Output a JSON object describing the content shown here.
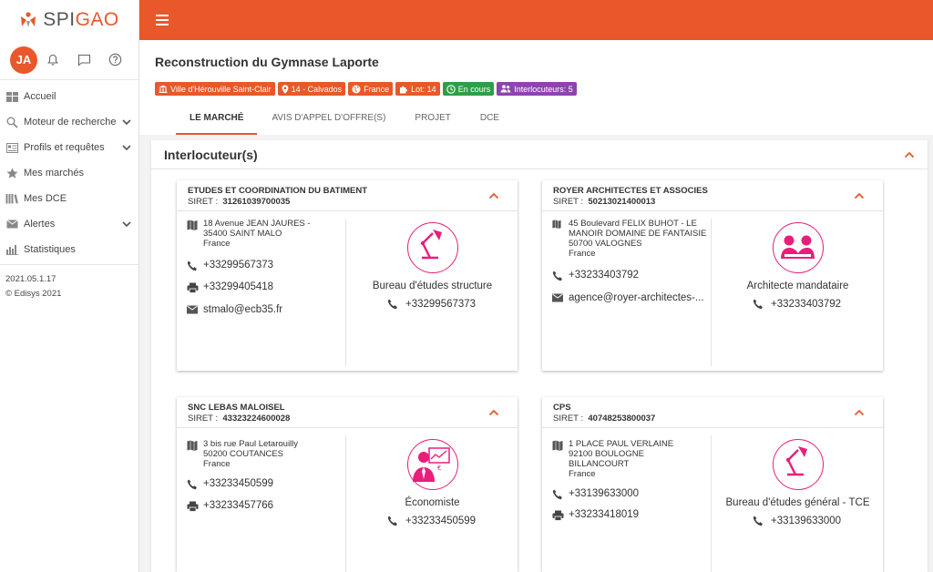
{
  "app": {
    "logo_prefix": "SPI",
    "logo_suffix": "GAO"
  },
  "user": {
    "initials": "JA"
  },
  "sidebar": {
    "items": [
      {
        "label": "Accueil",
        "icon": "dashboard-icon",
        "has_chevron": false
      },
      {
        "label": "Moteur de recherche",
        "icon": "search-icon",
        "has_chevron": true
      },
      {
        "label": "Profils et requêtes",
        "icon": "profile-icon",
        "has_chevron": true
      },
      {
        "label": "Mes marchés",
        "icon": "star-icon",
        "has_chevron": false
      },
      {
        "label": "Mes DCE",
        "icon": "books-icon",
        "has_chevron": false
      },
      {
        "label": "Alertes",
        "icon": "mail-icon",
        "has_chevron": true
      },
      {
        "label": "Statistiques",
        "icon": "bar-chart-icon",
        "has_chevron": false
      }
    ],
    "version": "2021.05.1.17",
    "copyright": "© Edisys 2021"
  },
  "header": {
    "title": "Reconstruction du Gymnase Laporte",
    "badges": [
      {
        "label": "Ville d'Hérouville Saint-Clair",
        "color": "#e8582a",
        "icon": "building-icon"
      },
      {
        "label": "14 - Calvados",
        "color": "#e8582a",
        "icon": "location-pin-icon"
      },
      {
        "label": "France",
        "color": "#e8582a",
        "icon": "globe-icon"
      },
      {
        "label": "Lot: 14",
        "color": "#e8582a",
        "icon": "puzzle-icon"
      },
      {
        "label": "En cours",
        "color": "#2e9e48",
        "icon": "clock-icon"
      },
      {
        "label": "Interlocuteurs: 5",
        "color": "#8e44ad",
        "icon": "people-icon"
      }
    ],
    "tabs": [
      {
        "label": "LE MARCHÉ",
        "active": true
      },
      {
        "label": "AVIS D'APPEL D'OFFRE(S)",
        "active": false
      },
      {
        "label": "PROJET",
        "active": false
      },
      {
        "label": "DCE",
        "active": false
      }
    ]
  },
  "panel": {
    "title": "Interlocuteur(s)"
  },
  "contacts": [
    {
      "name": "ETUDES ET COORDINATION DU BATIMENT",
      "siret_label": "SIRET :",
      "siret": "31261039700035",
      "address": [
        "18 Avenue JEAN JAURES -",
        "35400  SAINT MALO",
        "France"
      ],
      "phone": "+33299567373",
      "fax": "+33299405418",
      "email": "stmalo@ecb35.fr",
      "role": "Bureau d'études structure",
      "role_phone": "+33299567373",
      "illustration": "desk-lamp-icon"
    },
    {
      "name": "ROYER ARCHITECTES ET ASSOCIES",
      "siret_label": "SIRET :",
      "siret": "50213021400013",
      "address": [
        "45 Boulevard FELIX BUHOT - LE",
        "MANOIR DOMAINE DE FANTAISIE",
        "50700  VALOGNES",
        "France"
      ],
      "phone": "+33233403792",
      "email": "agence@royer-architectes-...",
      "role": "Architecte mandataire",
      "role_phone": "+33233403792",
      "illustration": "meeting-icon"
    },
    {
      "name": "SNC LEBAS MALOISEL",
      "siret_label": "SIRET :",
      "siret": "43323224600028",
      "address": [
        "3 bis rue Paul Letarouilly",
        "50200  COUTANCES",
        "France"
      ],
      "phone": "+33233450599",
      "fax": "+33233457766",
      "role": "Économiste",
      "role_phone": "+33233450599",
      "illustration": "economist-icon"
    },
    {
      "name": "CPS",
      "siret_label": "SIRET :",
      "siret": "40748253800037",
      "address": [
        "1 PLACE PAUL VERLAINE",
        "92100  BOULOGNE",
        "BILLANCOURT",
        "France"
      ],
      "phone": "+33139633000",
      "fax": "+33233418019",
      "role": "Bureau d'études général - TCE",
      "role_phone": "+33139633000",
      "illustration": "desk-lamp-icon"
    }
  ]
}
